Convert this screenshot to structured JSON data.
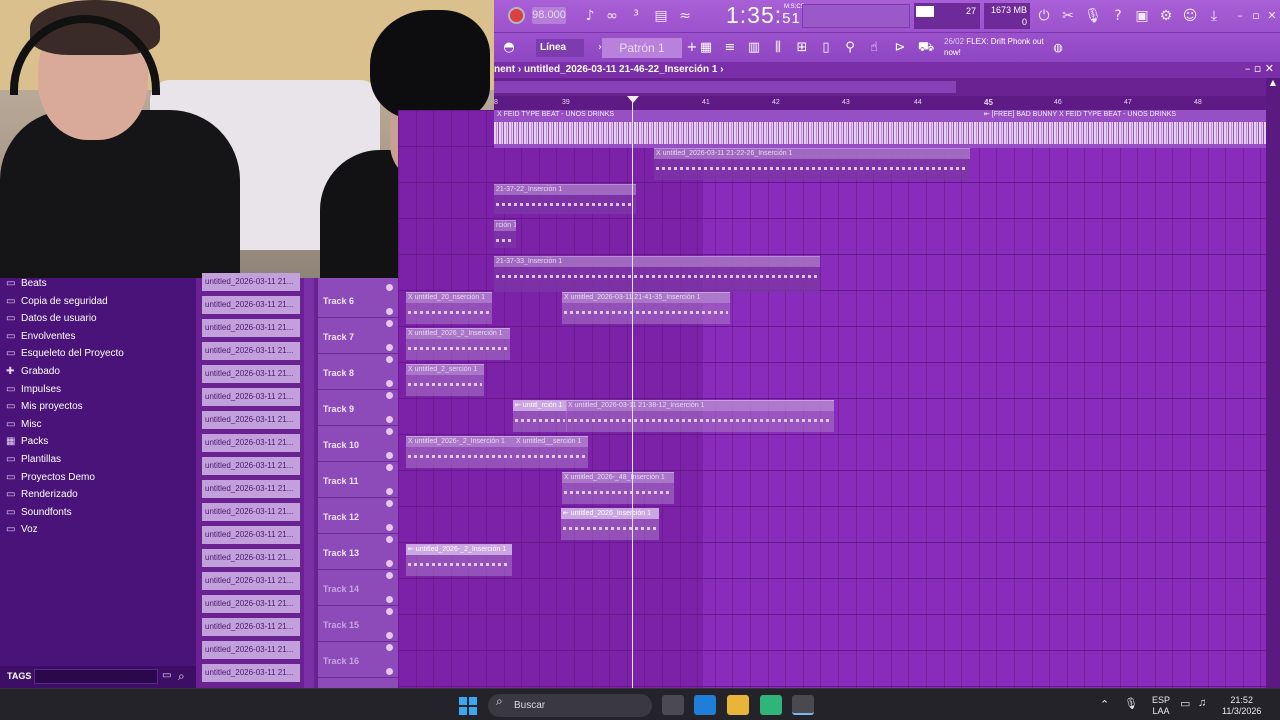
{
  "toolbar": {
    "tempo": "98.000",
    "clock_main": "1:35",
    "clock_small": "51",
    "clock_unit": "M:S:CS",
    "cpu_value": "27",
    "memory_value": "1673 MB",
    "memory_sub": "0",
    "mode": "Línea",
    "pattern": "Patrón 1",
    "news_date": "26/02",
    "news_text": "FLEX: Drift Phonk out now!"
  },
  "playlist": {
    "title": "nent › untitled_2026-03-11 21-46-22_Inserción 1 ›",
    "ruler": [
      "8",
      "39",
      "41",
      "42",
      "43",
      "44",
      "45",
      "46",
      "47",
      "48"
    ],
    "top_clip_left": "X FEID TYPE BEAT - UNOS DRINKS",
    "top_clip_right": "⇤ [FREE] BAD BUNNY X FEID TYPE BEAT - UNOS DRINKS",
    "clips": [
      "X untitled_2026-03-11 21-22-26_Inserción 1",
      "21-37-22_Inserción 1",
      "rción 1",
      "21-37-33_Inserción 1",
      "X untitled_20_nserción 1",
      "X untitled_2026-03-11 21-41-35_Inserción 1",
      "X untitled_2026_2_Inserción 1",
      "X untitled_2_serción 1",
      "⇤ untitl_rción 1",
      "X untitled_2026-03-11 21-38-12_Inserción 1",
      "X untitled_2026-_2_Inserción 1",
      "X untitled__serción 1",
      "X untitled_2026-_48_Inserción 1",
      "⇤ untitled_2026_Inserción 1",
      "⇤ untitled_2026-_2_Inserción 1"
    ]
  },
  "tracks": [
    "Track 6",
    "Track 7",
    "Track 8",
    "Track 9",
    "Track 10",
    "Track 11",
    "Track 12",
    "Track 13",
    "Track 14",
    "Track 15",
    "Track 16"
  ],
  "browser": {
    "items": [
      "Beats",
      "Copia de seguridad",
      "Datos de usuario",
      "Envolventes",
      "Esqueleto del Proyecto",
      "Grabado",
      "Impulses",
      "Mis proyectos",
      "Misc",
      "Packs",
      "Plantillas",
      "Proyectos Demo",
      "Renderizado",
      "Soundfonts",
      "Voz"
    ],
    "tags_label": "TAGS",
    "files": [
      "untitled_2026-03-11 21...",
      "untitled_2026-03-11 21...",
      "untitled_2026-03-11 21...",
      "untitled_2026-03-11 21...",
      "untitled_2026-03-11 21...",
      "untitled_2026-03-11 21...",
      "untitled_2026-03-11 21...",
      "untitled_2026-03-11 21...",
      "untitled_2026-03-11 21...",
      "untitled_2026-03-11 21...",
      "untitled_2026-03-11 21...",
      "untitled_2026-03-11 21...",
      "untitled_2026-03-11 21...",
      "untitled_2026-03-11 21...",
      "untitled_2026-03-11 21...",
      "untitled_2026-03-11 21...",
      "untitled_2026-03-11 21...",
      "untitled_2026-03-11 21..."
    ]
  },
  "taskbar": {
    "search": "Buscar",
    "lang": "ESP",
    "lang_sub": "LAA",
    "time": "21:52",
    "date": "11/3/2026"
  }
}
